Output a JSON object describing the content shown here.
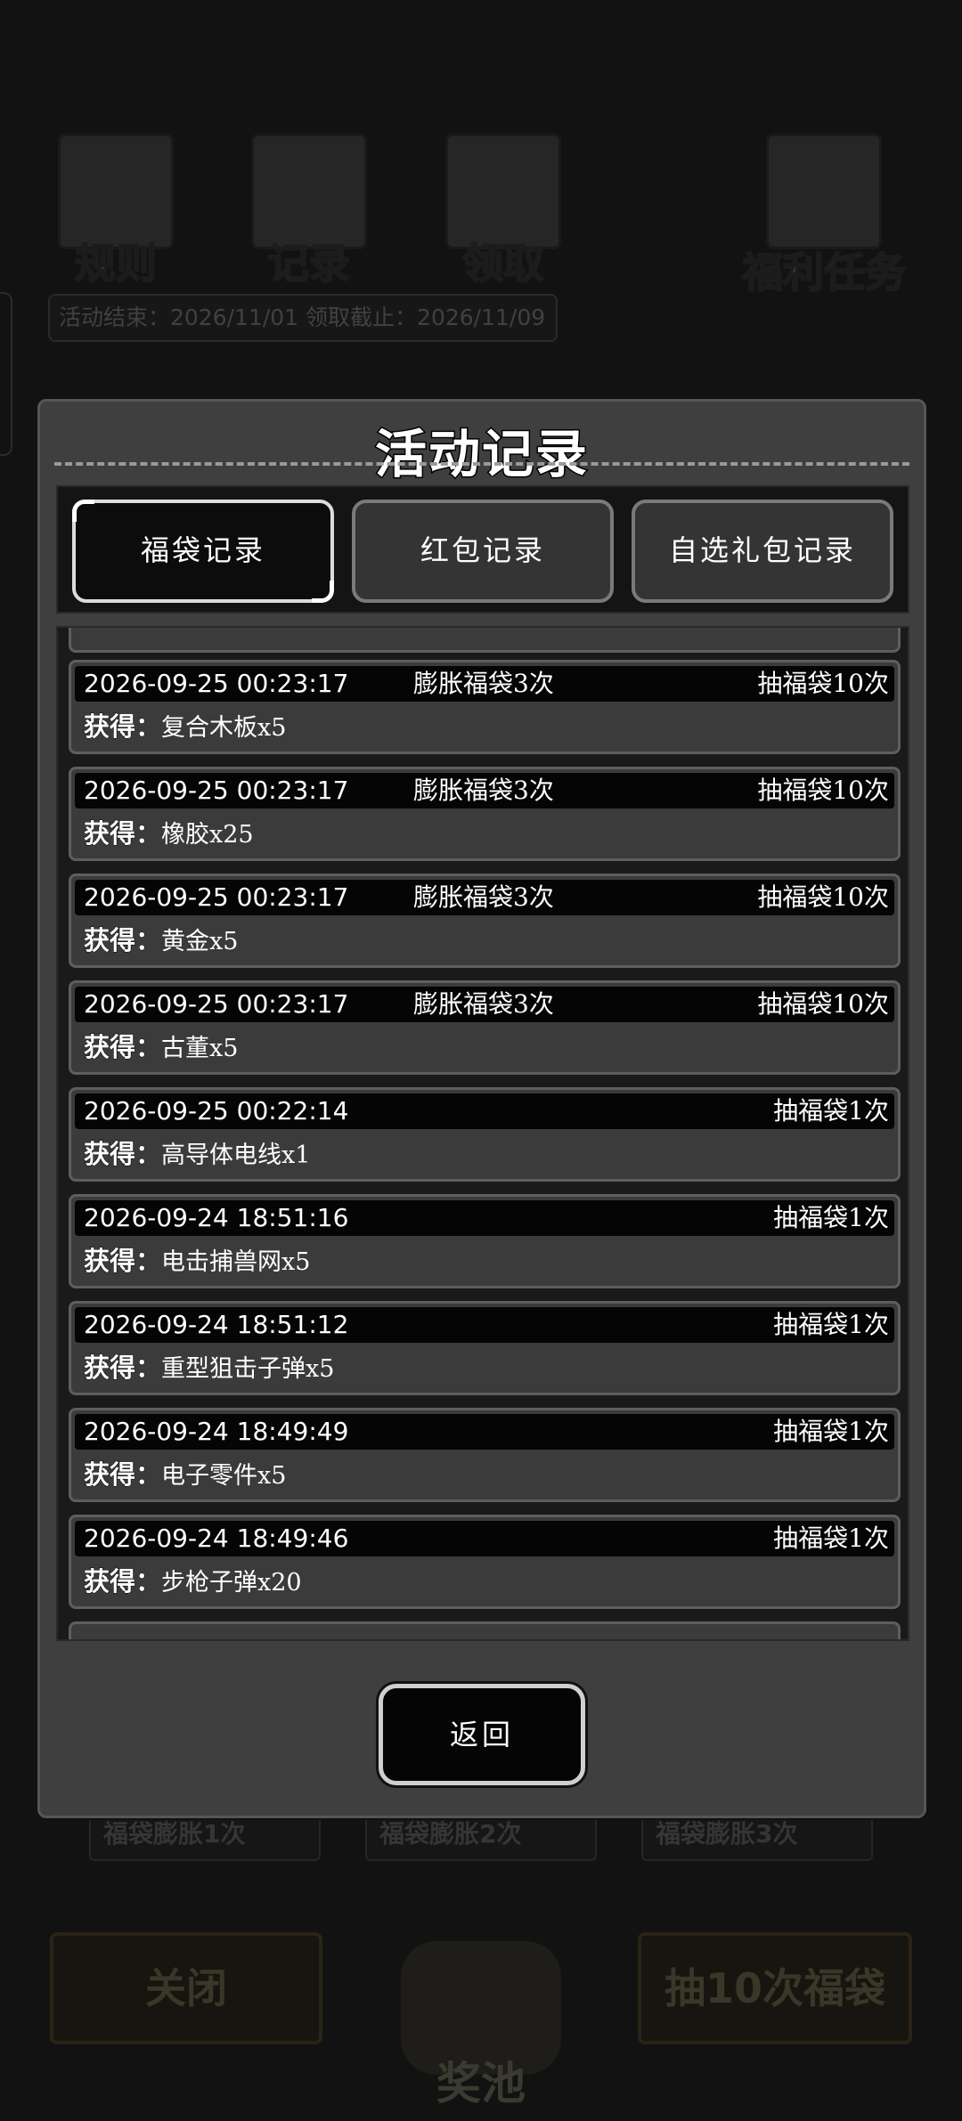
{
  "background": {
    "top_icons": [
      "规则",
      "记录",
      "领取",
      "福利任务"
    ],
    "date_strip": "活动结束：2026/11/01  领取截止：2026/11/09",
    "tiers": [
      "福袋膨胀1次",
      "福袋膨胀2次",
      "福袋膨胀3次"
    ],
    "close_label": "关闭",
    "pool_label": "奖池",
    "draw10_label": "抽10次福袋"
  },
  "modal": {
    "title": "活动记录",
    "tabs": [
      "福袋记录",
      "红包记录",
      "自选礼包记录"
    ],
    "active_tab": 0,
    "gain_label": "获得：",
    "records": [
      {
        "time": "2026-09-25 00:23:17",
        "multiplier": "膨胀福袋3次",
        "draw": "抽福袋10次",
        "item": "复合木板x5"
      },
      {
        "time": "2026-09-25 00:23:17",
        "multiplier": "膨胀福袋3次",
        "draw": "抽福袋10次",
        "item": "橡胶x25"
      },
      {
        "time": "2026-09-25 00:23:17",
        "multiplier": "膨胀福袋3次",
        "draw": "抽福袋10次",
        "item": "黄金x5"
      },
      {
        "time": "2026-09-25 00:23:17",
        "multiplier": "膨胀福袋3次",
        "draw": "抽福袋10次",
        "item": "古董x5"
      },
      {
        "time": "2026-09-25 00:22:14",
        "multiplier": "",
        "draw": "抽福袋1次",
        "item": "高导体电线x1"
      },
      {
        "time": "2026-09-24 18:51:16",
        "multiplier": "",
        "draw": "抽福袋1次",
        "item": "电击捕兽网x5"
      },
      {
        "time": "2026-09-24 18:51:12",
        "multiplier": "",
        "draw": "抽福袋1次",
        "item": "重型狙击子弹x5"
      },
      {
        "time": "2026-09-24 18:49:49",
        "multiplier": "",
        "draw": "抽福袋1次",
        "item": "电子零件x5"
      },
      {
        "time": "2026-09-24 18:49:46",
        "multiplier": "",
        "draw": "抽福袋1次",
        "item": "步枪子弹x20"
      }
    ],
    "return_label": "返回"
  }
}
